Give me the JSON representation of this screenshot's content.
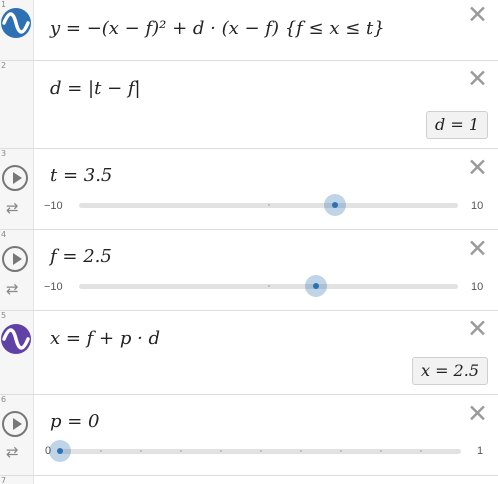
{
  "expressions": [
    {
      "number": "1",
      "icon": "wave-blue-icon",
      "latex": "y = −(x − f)² + d · (x − f)  {f ≤ x ≤ t}"
    },
    {
      "number": "2",
      "latex": "d = |t − f|",
      "result": "d  =  1"
    },
    {
      "number": "3",
      "latex": "t = 3.5",
      "slider": {
        "min": "−10",
        "max": "10",
        "value": 3.5,
        "range": [
          -10,
          10
        ]
      }
    },
    {
      "number": "4",
      "latex": "f = 2.5",
      "slider": {
        "min": "−10",
        "max": "10",
        "value": 2.5,
        "range": [
          -10,
          10
        ]
      }
    },
    {
      "number": "5",
      "icon": "wave-purple-icon",
      "latex": "x  = f + p · d",
      "result": "x  =  2.5"
    },
    {
      "number": "6",
      "latex": "p = 0",
      "slider": {
        "min": "0",
        "max": "1",
        "value": 0,
        "range": [
          0,
          1
        ]
      }
    },
    {
      "number": "7"
    }
  ],
  "icons": {
    "close": "✕",
    "loop": "⇄"
  },
  "colors": {
    "blue": "#2d70b3",
    "purple": "#6042a6"
  }
}
